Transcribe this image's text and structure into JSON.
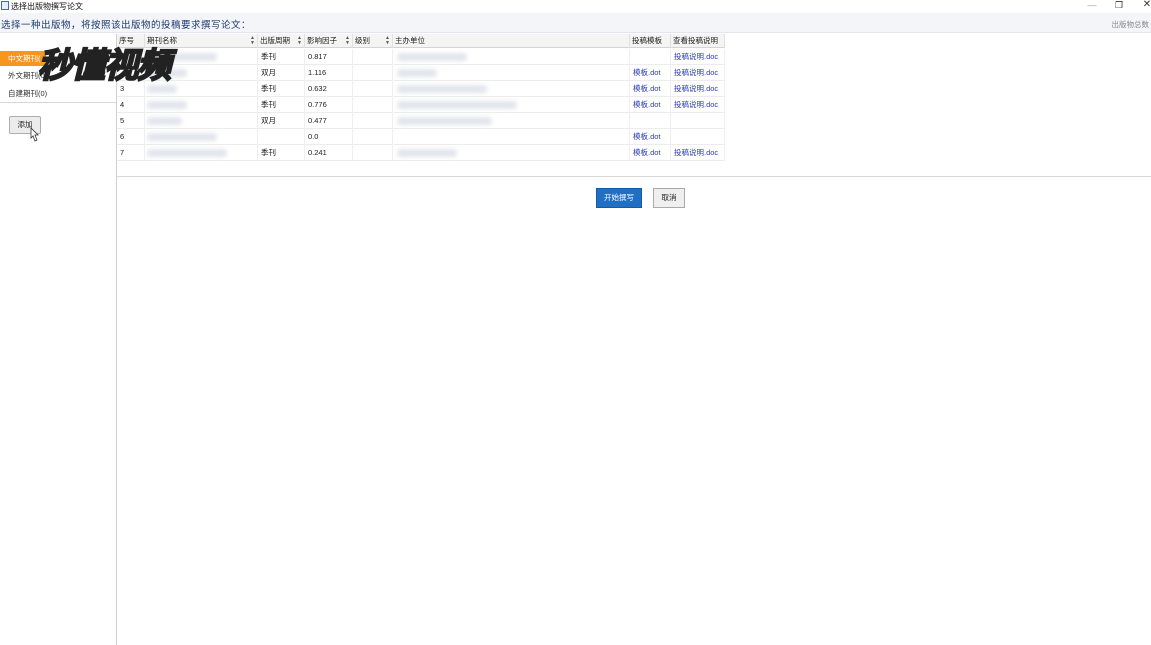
{
  "window": {
    "title": "选择出版物撰写论文",
    "minimize": "—",
    "restore": "❐",
    "close": "✕"
  },
  "header": {
    "instruction": "选择一种出版物，将按照该出版物的投稿要求撰写论文：",
    "right_text": "出版物总数"
  },
  "sidebar": {
    "items": [
      {
        "label": "中文期刊(",
        "active": true
      },
      {
        "label": "外文期刊(0)",
        "active": false
      },
      {
        "label": "自建期刊(0)",
        "active": false
      }
    ],
    "add_label": "添加"
  },
  "watermark": "秒懂视频",
  "table": {
    "columns": [
      "序号",
      "期刊名称",
      "出版周期",
      "影响因子",
      "级别",
      "主办单位",
      "投稿模板",
      "查看投稿说明"
    ],
    "rows": [
      {
        "no": "",
        "cycle": "季刊",
        "impact": "0.817",
        "template": "",
        "guide": "投稿说明.doc"
      },
      {
        "no": "",
        "cycle": "双月",
        "impact": "1.116",
        "template": "模板.dot",
        "guide": "投稿说明.doc"
      },
      {
        "no": "3",
        "cycle": "季刊",
        "impact": "0.632",
        "template": "模板.dot",
        "guide": "投稿说明.doc"
      },
      {
        "no": "4",
        "cycle": "季刊",
        "impact": "0.776",
        "template": "模板.dot",
        "guide": "投稿说明.doc"
      },
      {
        "no": "5",
        "cycle": "双月",
        "impact": "0.477",
        "template": "",
        "guide": ""
      },
      {
        "no": "6",
        "cycle": "",
        "impact": "0.0",
        "template": "模板.dot",
        "guide": ""
      },
      {
        "no": "7",
        "cycle": "季刊",
        "impact": "0.241",
        "template": "模板.dot",
        "guide": "投稿说明.doc"
      }
    ]
  },
  "actions": {
    "start_label": "开始撰写",
    "cancel_label": "取消"
  },
  "colors": {
    "accent": "#1f6fc5",
    "sidebar_active": "#f7961e",
    "link": "#2a3fb5"
  }
}
